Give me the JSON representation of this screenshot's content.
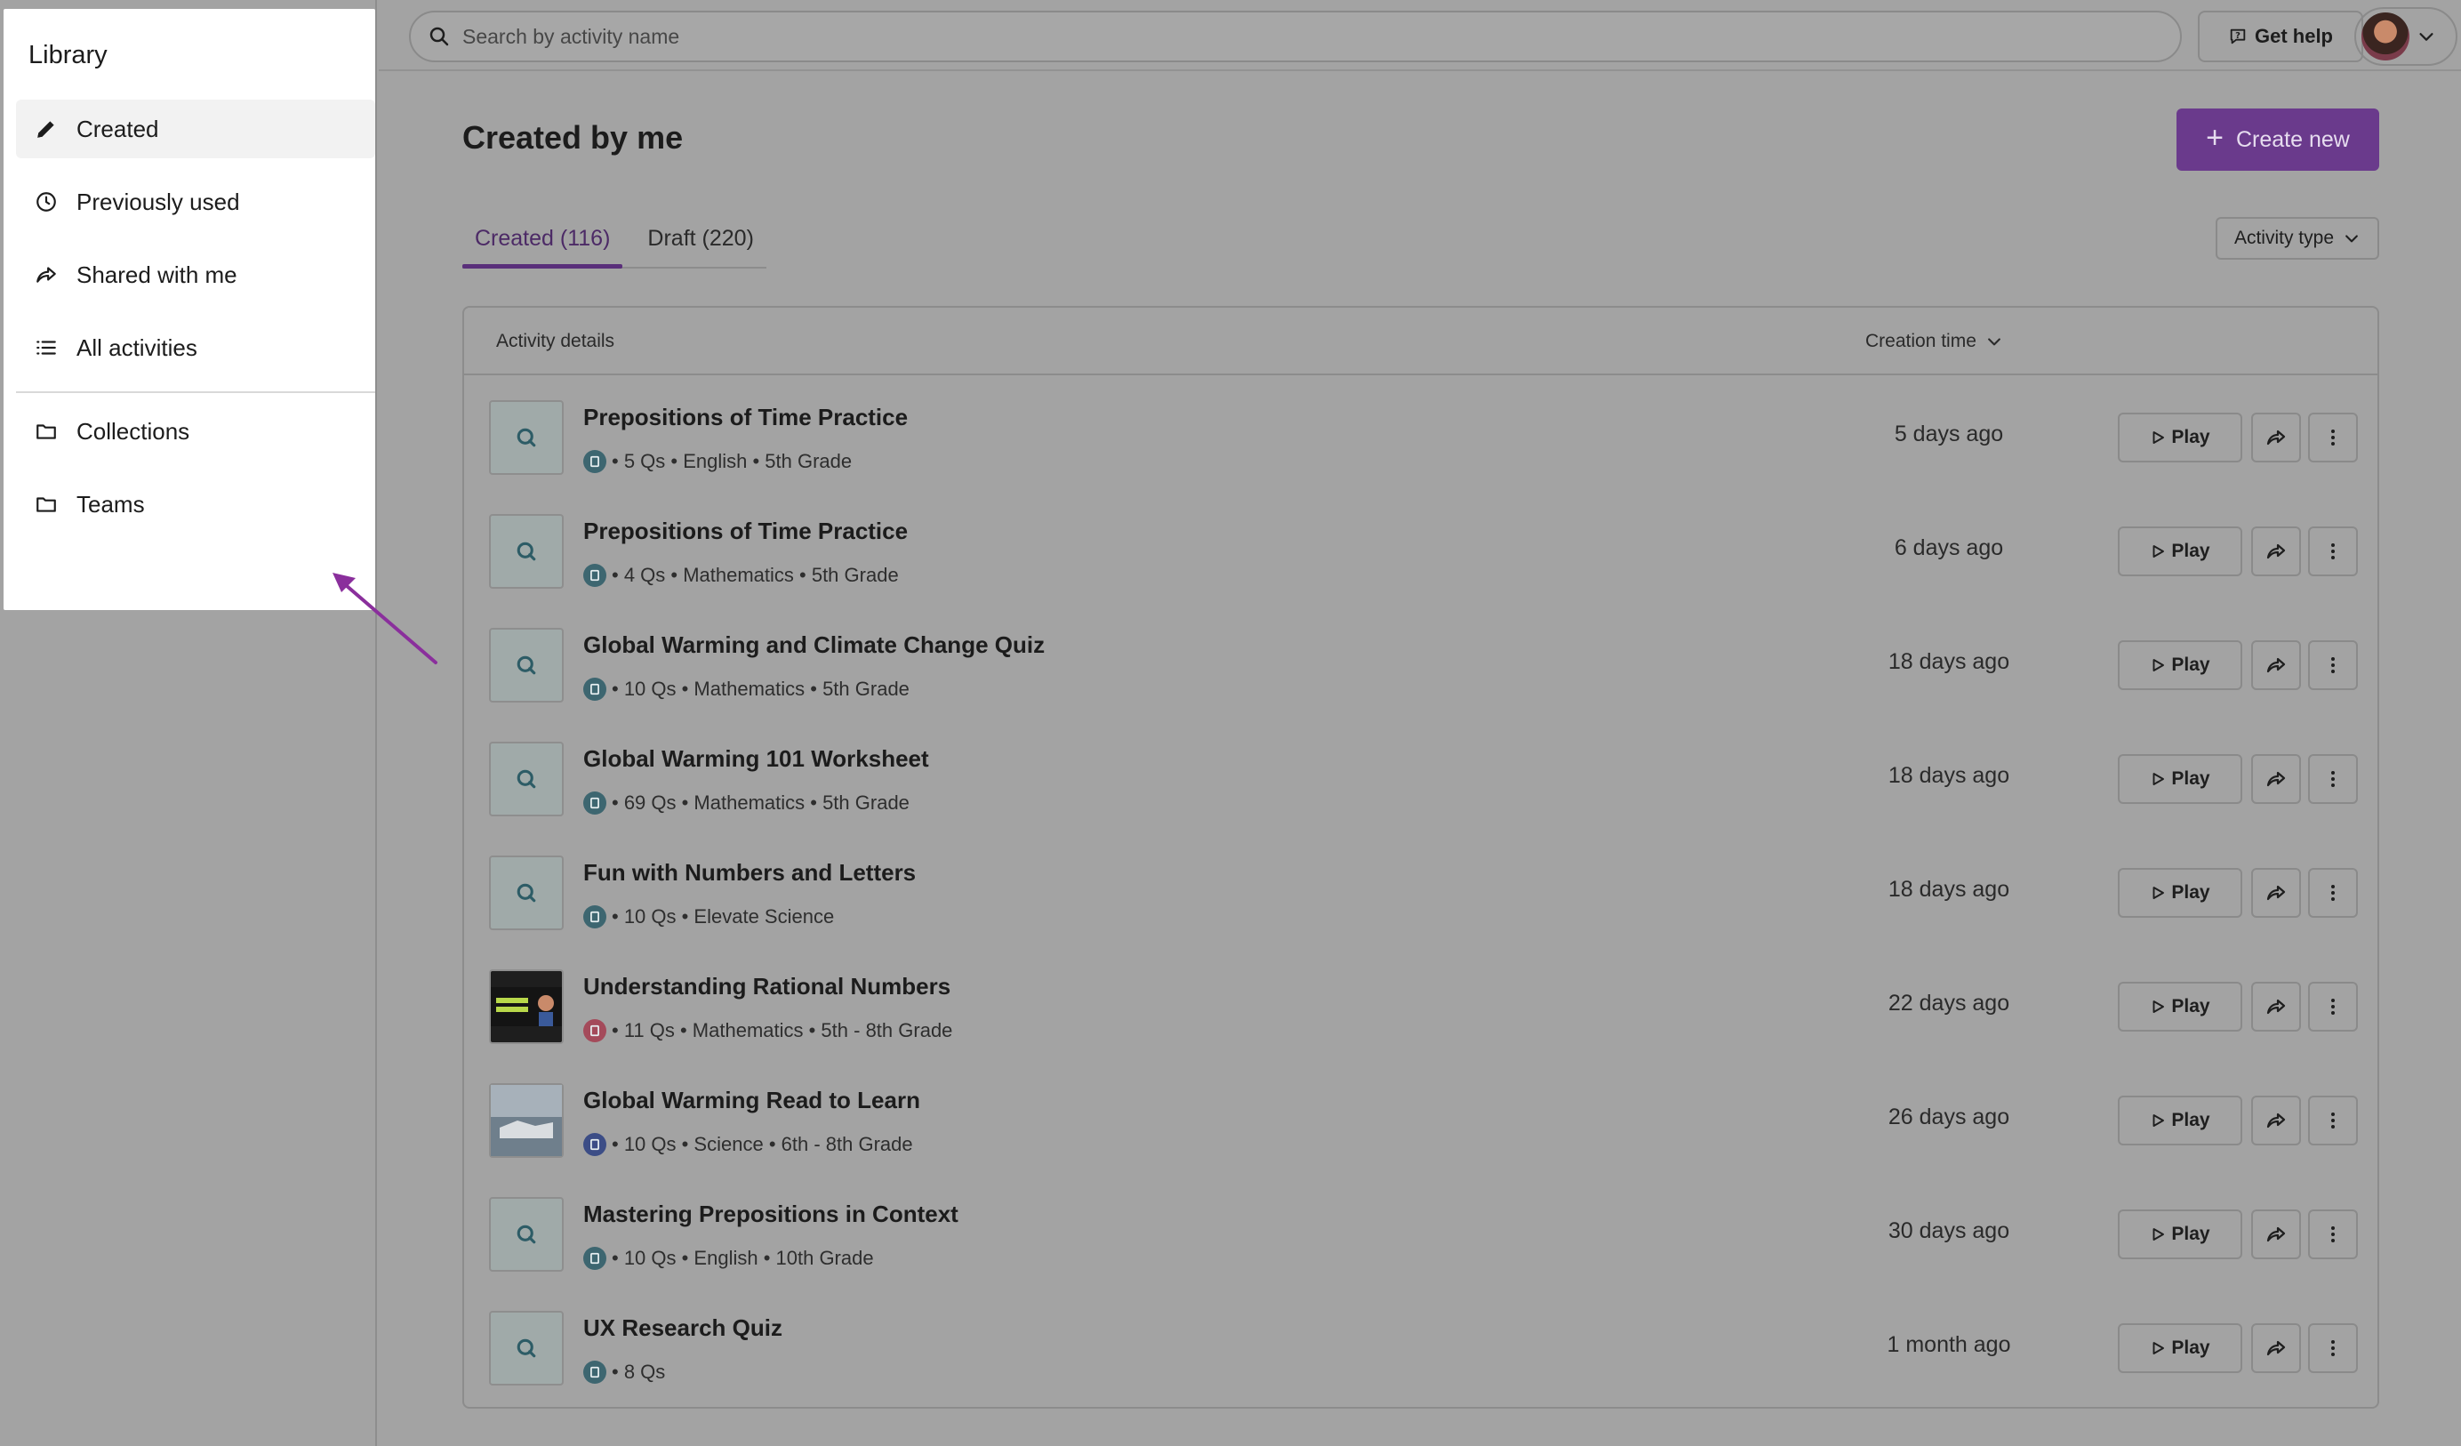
{
  "sidebar": {
    "title": "Library",
    "items": [
      {
        "label": "Created",
        "icon": "pencil-icon",
        "active": true
      },
      {
        "label": "Previously used",
        "icon": "clock-icon"
      },
      {
        "label": "Shared with me",
        "icon": "share-icon"
      },
      {
        "label": "All activities",
        "icon": "list-icon"
      }
    ],
    "secondary_items": [
      {
        "label": "Collections",
        "icon": "folder-icon"
      },
      {
        "label": "Teams",
        "icon": "folder-icon"
      }
    ]
  },
  "topbar": {
    "search_placeholder": "Search by activity name",
    "help_label": "Get help"
  },
  "main": {
    "title": "Created by me",
    "create_label": "Create new",
    "tabs": [
      {
        "label": "Created (116)",
        "active": true
      },
      {
        "label": "Draft (220)"
      }
    ],
    "filter_label": "Activity type",
    "table": {
      "col_details": "Activity details",
      "col_time": "Creation time",
      "play_label": "Play",
      "rows": [
        {
          "title": "Prepositions of Time Practice",
          "meta": "• 5 Qs • English • 5th Grade",
          "time": "5 days ago",
          "thumb": "quiz",
          "kind": "quiz"
        },
        {
          "title": "Prepositions of Time Practice",
          "meta": "• 4 Qs • Mathematics • 5th Grade",
          "time": "6 days ago",
          "thumb": "quiz",
          "kind": "quiz"
        },
        {
          "title": "Global Warming and Climate Change Quiz",
          "meta": "• 10 Qs • Mathematics • 5th Grade",
          "time": "18 days ago",
          "thumb": "quiz",
          "kind": "quiz"
        },
        {
          "title": "Global Warming 101 Worksheet",
          "meta": "• 69 Qs • Mathematics • 5th Grade",
          "time": "18 days ago",
          "thumb": "quiz",
          "kind": "quiz"
        },
        {
          "title": "Fun with Numbers and Letters",
          "meta": "• 10 Qs • Elevate Science",
          "time": "18 days ago",
          "thumb": "quiz",
          "kind": "quiz"
        },
        {
          "title": "Understanding Rational Numbers",
          "meta": "• 11 Qs • Mathematics • 5th - 8th Grade",
          "time": "22 days ago",
          "thumb": "video",
          "kind": "video"
        },
        {
          "title": "Global Warming Read to Learn",
          "meta": "• 10 Qs • Science • 6th - 8th Grade",
          "time": "26 days ago",
          "thumb": "image",
          "kind": "blue"
        },
        {
          "title": "Mastering Prepositions in Context",
          "meta": "• 10 Qs • English • 10th Grade",
          "time": "30 days ago",
          "thumb": "quiz",
          "kind": "quiz"
        },
        {
          "title": "UX Research Quiz",
          "meta": "• 8 Qs",
          "time": "1 month ago",
          "thumb": "quiz",
          "kind": "quiz"
        }
      ]
    }
  },
  "colors": {
    "accent": "#6a3a8c",
    "overlay": "#a3a3a3",
    "annotation_arrow": "#8a2f9c"
  }
}
